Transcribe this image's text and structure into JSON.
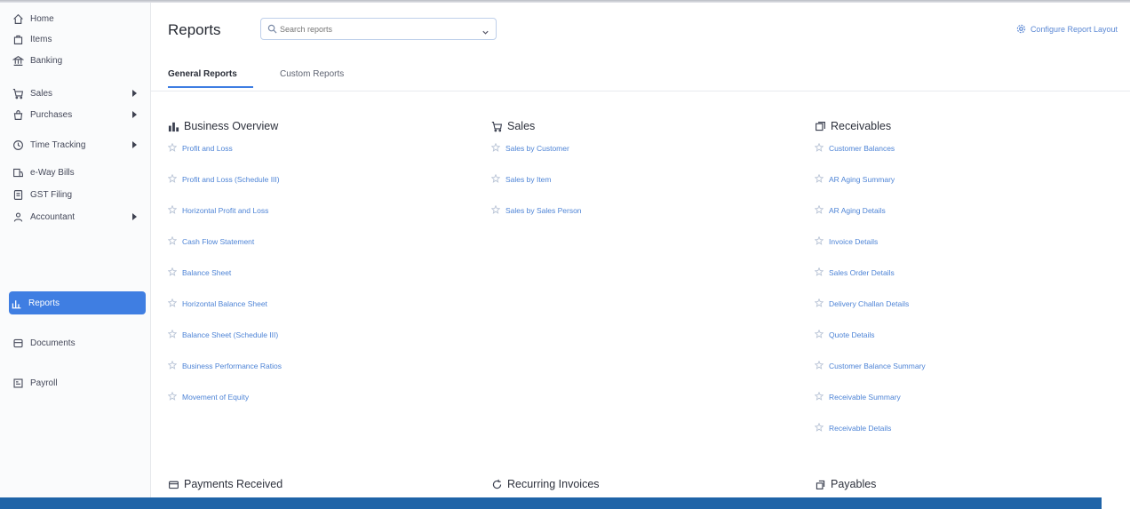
{
  "sidebar": {
    "items": [
      {
        "label": "Home",
        "icon": "home-icon",
        "has_submenu": false
      },
      {
        "label": "Items",
        "icon": "tag-icon",
        "has_submenu": false
      },
      {
        "label": "Banking",
        "icon": "bank-icon",
        "has_submenu": false
      },
      {
        "label": "Sales",
        "icon": "cart-icon",
        "has_submenu": true
      },
      {
        "label": "Purchases",
        "icon": "bag-icon",
        "has_submenu": true
      },
      {
        "label": "Time Tracking",
        "icon": "clock-icon",
        "has_submenu": true
      },
      {
        "label": "e-Way Bills",
        "icon": "truck-icon",
        "has_submenu": false
      },
      {
        "label": "GST Filing",
        "icon": "document-icon",
        "has_submenu": false
      },
      {
        "label": "Accountant",
        "icon": "user-icon",
        "has_submenu": true
      },
      {
        "label": "Reports",
        "icon": "chart-icon",
        "has_submenu": false,
        "active": true
      },
      {
        "label": "Documents",
        "icon": "folder-icon",
        "has_submenu": false
      },
      {
        "label": "Payroll",
        "icon": "payroll-icon",
        "has_submenu": false
      }
    ]
  },
  "header": {
    "title": "Reports",
    "search_placeholder": "Search reports",
    "configure_label": "Configure Report Layout"
  },
  "tabs": [
    {
      "label": "General Reports",
      "active": true
    },
    {
      "label": "Custom Reports",
      "active": false
    }
  ],
  "sections": {
    "business_overview": {
      "title": "Business Overview",
      "icon": "bar-chart-icon",
      "items": [
        "Profit and Loss",
        "Profit and Loss (Schedule III)",
        "Horizontal Profit and Loss",
        "Cash Flow Statement",
        "Balance Sheet",
        "Horizontal Balance Sheet",
        "Balance Sheet (Schedule III)",
        "Business Performance Ratios",
        "Movement of Equity"
      ]
    },
    "sales": {
      "title": "Sales",
      "icon": "cart-icon",
      "items": [
        "Sales by Customer",
        "Sales by Item",
        "Sales by Sales Person"
      ]
    },
    "receivables": {
      "title": "Receivables",
      "icon": "receivables-icon",
      "items": [
        "Customer Balances",
        "AR Aging Summary",
        "AR Aging Details",
        "Invoice Details",
        "Sales Order Details",
        "Delivery Challan Details",
        "Quote Details",
        "Customer Balance Summary",
        "Receivable Summary",
        "Receivable Details"
      ]
    },
    "payments_received": {
      "title": "Payments Received",
      "icon": "card-icon"
    },
    "recurring_invoices": {
      "title": "Recurring Invoices",
      "icon": "recurring-icon"
    },
    "payables": {
      "title": "Payables",
      "icon": "payables-icon"
    }
  },
  "colors": {
    "accent": "#3f7ee2",
    "link": "#4e84d6",
    "status_bar": "#1f64a8"
  }
}
